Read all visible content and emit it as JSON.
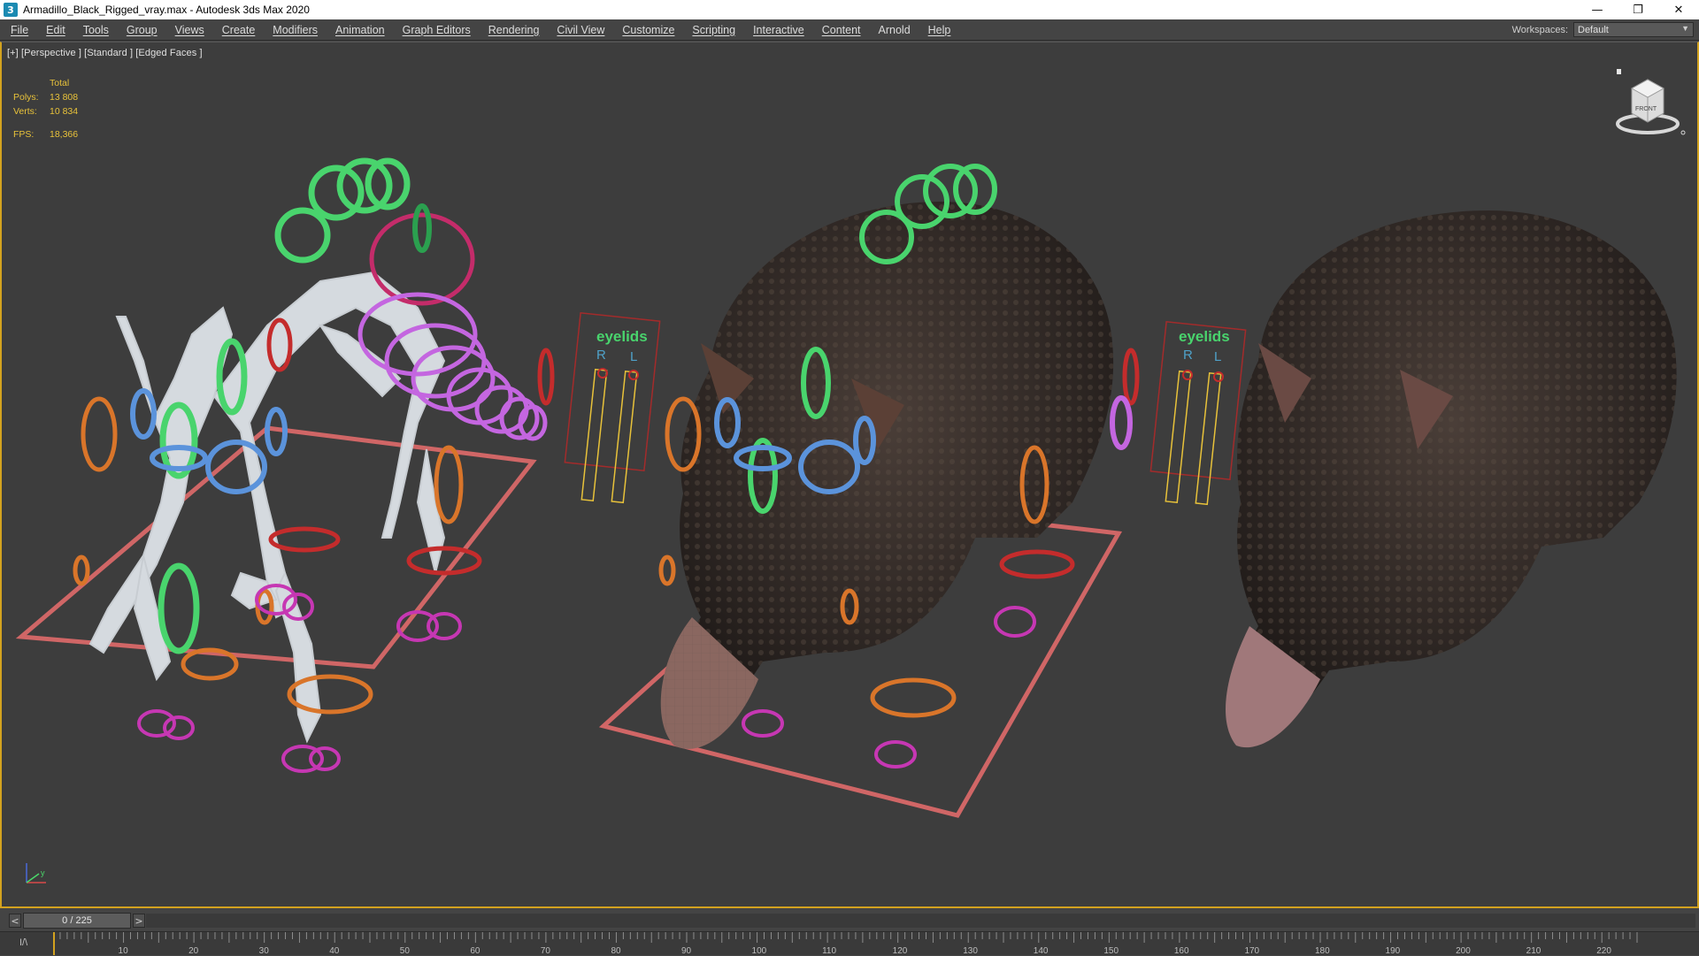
{
  "window": {
    "icon_glyph": "3",
    "title": "Armadillo_Black_Rigged_vray.max - Autodesk 3ds Max 2020",
    "minimize_glyph": "—",
    "restore_glyph": "❐",
    "close_glyph": "✕"
  },
  "menus": [
    {
      "label": "File",
      "underlined": true
    },
    {
      "label": "Edit",
      "underlined": true
    },
    {
      "label": "Tools",
      "underlined": true
    },
    {
      "label": "Group",
      "underlined": true
    },
    {
      "label": "Views",
      "underlined": true
    },
    {
      "label": "Create",
      "underlined": true
    },
    {
      "label": "Modifiers",
      "underlined": true
    },
    {
      "label": "Animation",
      "underlined": true
    },
    {
      "label": "Graph Editors",
      "underlined": true
    },
    {
      "label": "Rendering",
      "underlined": true
    },
    {
      "label": "Civil View",
      "underlined": true
    },
    {
      "label": "Customize",
      "underlined": true
    },
    {
      "label": "Scripting",
      "underlined": true
    },
    {
      "label": "Interactive",
      "underlined": true
    },
    {
      "label": "Content",
      "underlined": true
    },
    {
      "label": "Arnold",
      "underlined": false
    },
    {
      "label": "Help",
      "underlined": true
    }
  ],
  "workspace": {
    "label": "Workspaces:",
    "value": "Default"
  },
  "viewport": {
    "label": "[+] [Perspective ] [Standard ] [Edged Faces ]",
    "stats": {
      "header": "Total",
      "polys_label": "Polys:",
      "polys_value": "13 808",
      "verts_label": "Verts:",
      "verts_value": "10 834",
      "fps_label": "FPS:",
      "fps_value": "18,366"
    },
    "eyelids_label": "eyelids",
    "eyelid_right": "R",
    "eyelid_left": "L",
    "viewcube_face": "FRONT",
    "axis_labels": {
      "x": "x",
      "y": "y",
      "z": "z"
    }
  },
  "timeline": {
    "frame_display": "0 / 225",
    "prev_glyph": "<",
    "next_glyph": ">",
    "current_frame": 0,
    "total_frames": 225,
    "ruler_labels": [
      "10",
      "20",
      "30",
      "40",
      "50",
      "60",
      "70",
      "80",
      "90",
      "100",
      "110",
      "120",
      "130",
      "140",
      "150",
      "160",
      "170",
      "180",
      "190",
      "200",
      "210",
      "220"
    ],
    "key_icon": "I/\\"
  },
  "colors": {
    "accent": "#d3a21f",
    "viewport_bg": "#3d3d3d",
    "stats_text": "#e8c23a",
    "control_green": "#49d46d",
    "control_blue": "#5b93db",
    "control_orange": "#d9752a",
    "control_red": "#c42c2c",
    "control_magenta": "#c637b3",
    "control_violet": "#c466e0",
    "ground_grid": "#e06a6a"
  }
}
